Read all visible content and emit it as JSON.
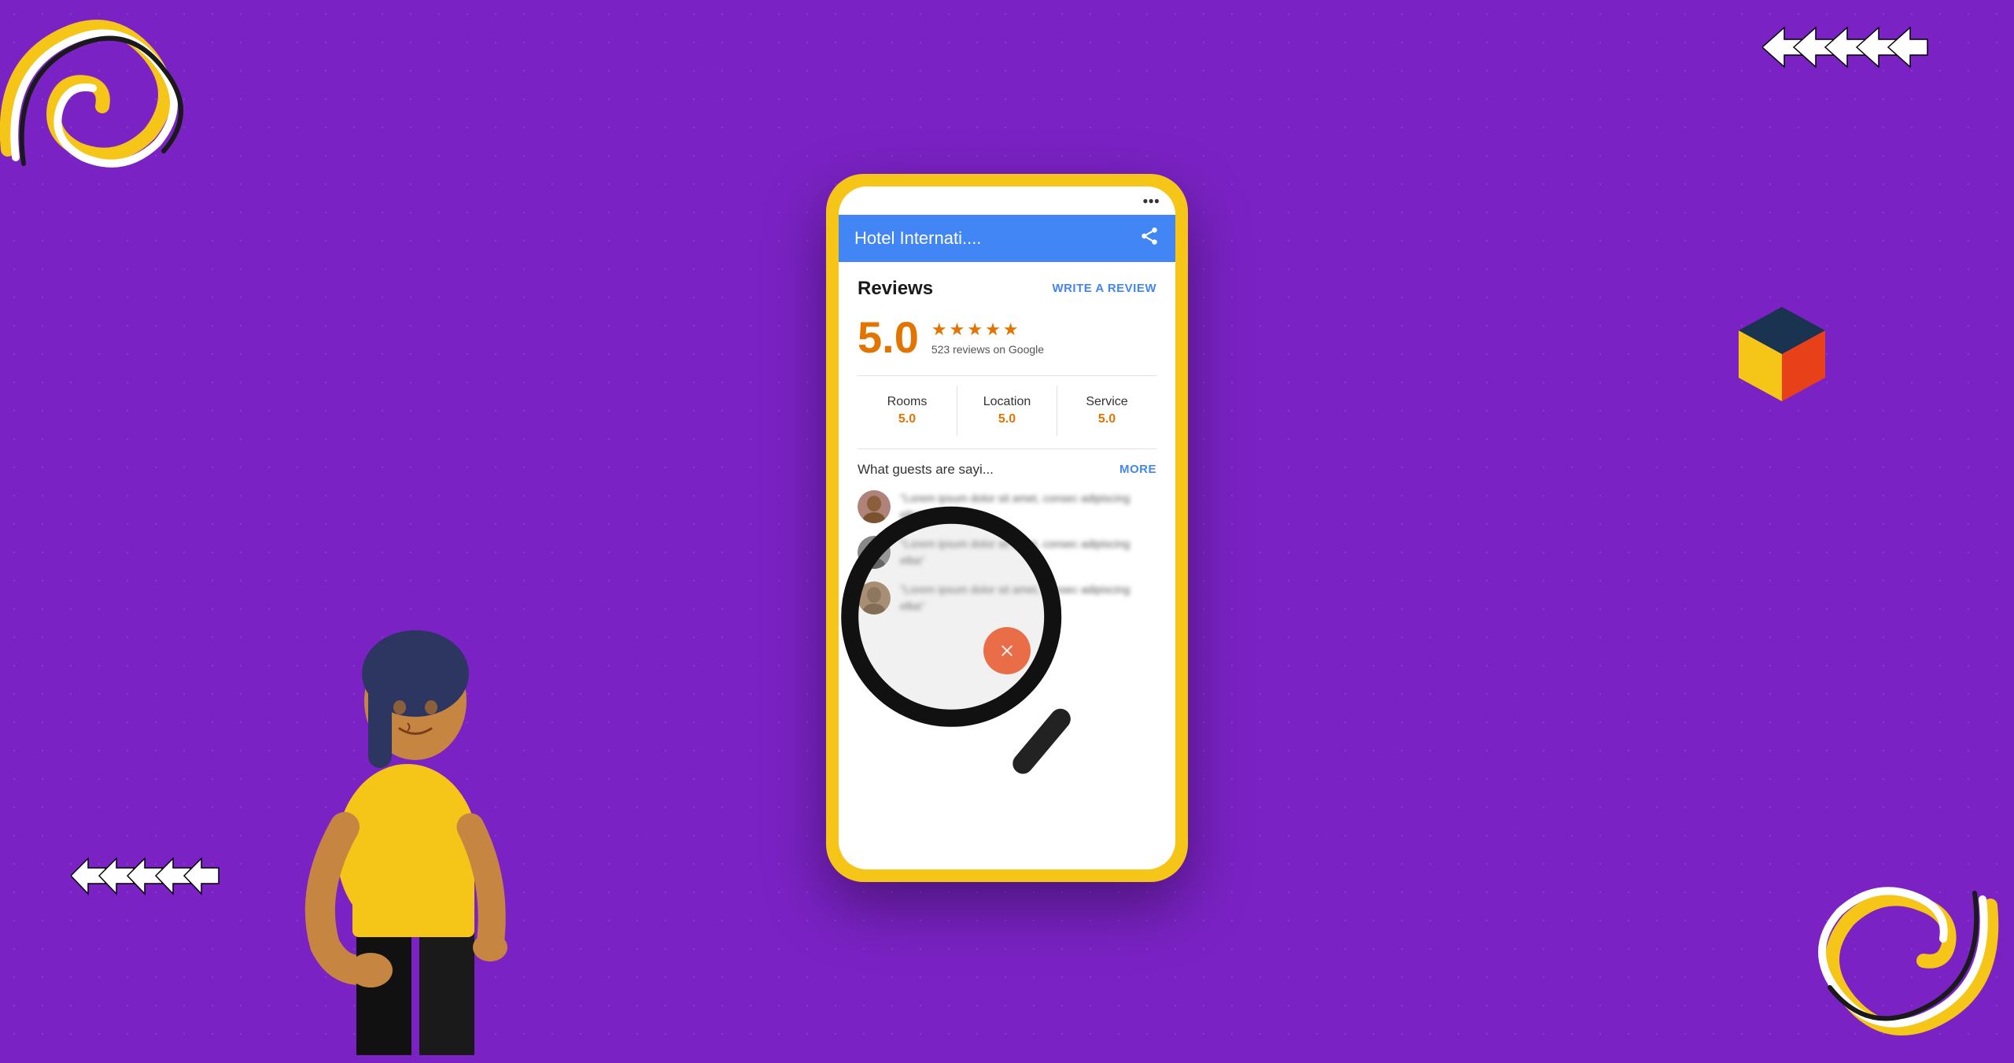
{
  "background": {
    "color": "#7B22C5"
  },
  "phone": {
    "frame_color": "#F5C518",
    "header": {
      "background": "#4285F4",
      "title": "Hotel Internati....",
      "share_label": "share"
    },
    "reviews_section": {
      "title": "Reviews",
      "write_review_label": "WRITE A REVIEW",
      "overall_rating": "5.0",
      "stars_count": 5,
      "reviews_count_text": "523 reviews on Google",
      "categories": [
        {
          "name": "Rooms",
          "score": "5.0"
        },
        {
          "name": "Location",
          "score": "5.0"
        },
        {
          "name": "Service",
          "score": "5.0"
        }
      ],
      "guests_section_title": "What guests are sayi...",
      "more_label": "MORE",
      "reviews": [
        {
          "text": "Lorem ipsum dolor sit amet, consec adipiscing elba..."
        },
        {
          "text": "Lorem ipsum dolor sit amet, consec adipiscing elba..."
        },
        {
          "text": "Lorem ipsum dolor sit amet, consec adipiscing elba..."
        }
      ]
    }
  },
  "decorations": {
    "arrows_top_right_count": 5,
    "arrows_bottom_left_count": 5
  }
}
